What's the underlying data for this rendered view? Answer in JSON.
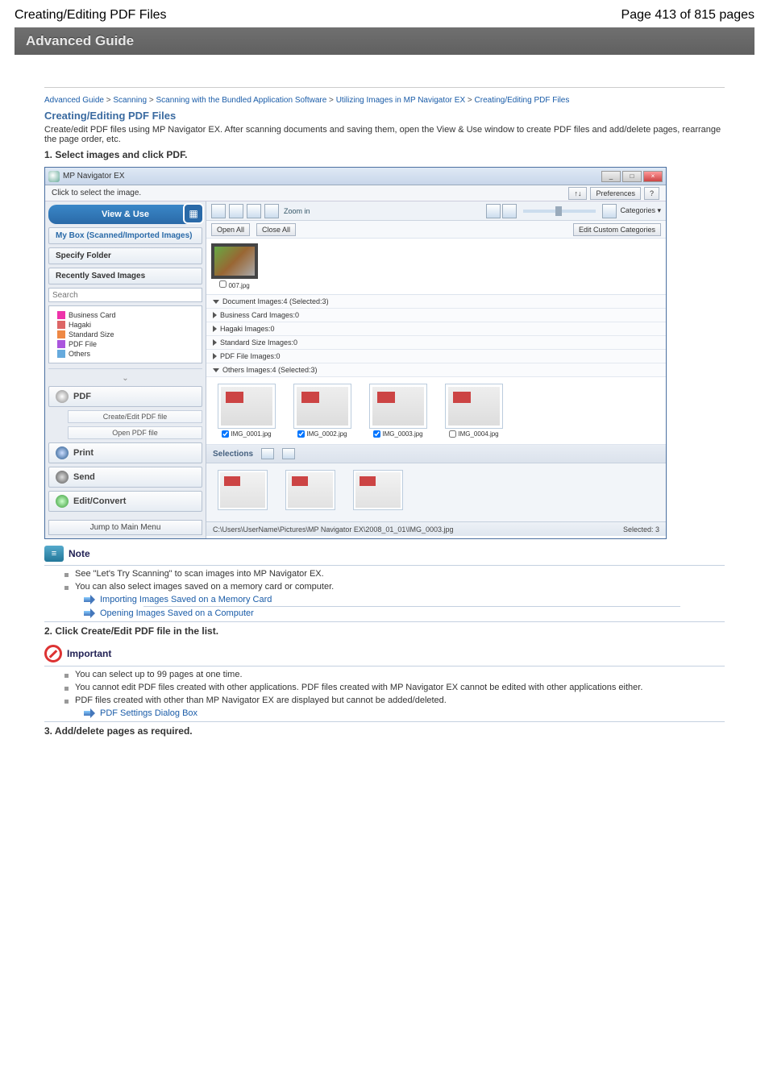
{
  "page": {
    "title_left": "Creating/Editing PDF Files",
    "title_right": "Page 413 of 815 pages",
    "advanced": "Advanced Guide"
  },
  "breadcrumb": [
    "Advanced Guide",
    "Scanning",
    "Scanning with the Bundled Application Software",
    "Utilizing Images in MP Navigator EX",
    "Creating/Editing PDF Files"
  ],
  "sep": " > ",
  "h1": "Creating/Editing PDF Files",
  "intro": "Create/edit PDF files using MP Navigator EX. After scanning documents and saving them, open the View & Use window to create PDF files and add/delete pages, rearrange the page order, etc.",
  "step1": "1. Select images and click PDF.",
  "app": {
    "title": "MP Navigator EX",
    "hint": "Click to select the image.",
    "prefs": "Preferences",
    "sort_ic": "↑↓",
    "help": "?",
    "view_use": "View & Use",
    "nav": {
      "mybox": "My Box (Scanned/Imported Images)",
      "specify": "Specify Folder",
      "recent": "Recently Saved Images"
    },
    "search_ph": "Search",
    "categories_label": "Categories",
    "cats": {
      "business": "Business Card",
      "hagaki": "Hagaki",
      "standard": "Standard Size",
      "pdffile": "PDF File",
      "others": "Others"
    },
    "side": {
      "pdf": "PDF",
      "create": "Create/Edit PDF file",
      "open": "Open PDF file",
      "print": "Print",
      "send": "Send",
      "edit": "Edit/Convert",
      "jump": "Jump to Main Menu"
    },
    "toolbar": {
      "zoom": "Zoom in",
      "cats": "Categories"
    },
    "open_all": "Open All",
    "close_all": "Close All",
    "edit_custom": "Edit Custom Categories",
    "thumb_name": "007.jpg",
    "rows": {
      "doc": "Document   Images:4   (Selected:3)",
      "business": "Business Card   Images:0",
      "hagaki": "Hagaki   Images:0",
      "standard": "Standard Size   Images:0",
      "pdffile": "PDF File   Images:0",
      "others": "Others   Images:4   (Selected:3)"
    },
    "imgs": [
      "IMG_0001.jpg",
      "IMG_0002.jpg",
      "IMG_0003.jpg",
      "IMG_0004.jpg"
    ],
    "selections": "Selections",
    "status_path": "C:\\Users\\UserName\\Pictures\\MP Navigator EX\\2008_01_01\\IMG_0003.jpg",
    "status_sel": "Selected: 3"
  },
  "notebox": {
    "label": "Note"
  },
  "notes": {
    "b1": "See \"Let's Try Scanning\" to scan images into MP Navigator EX.",
    "b2": "You can also select images saved on a memory card or computer.",
    "a1": "Importing Images Saved on a Memory Card",
    "a2": "Opening Images Saved on a Computer"
  },
  "step2": "2. Click Create/Edit PDF file in the list.",
  "important": {
    "label": "Important"
  },
  "imps": {
    "b1": "You can select up to 99 pages at one time.",
    "b2": "You cannot edit PDF files created with other applications. PDF files created with MP Navigator EX cannot be edited with other applications either.",
    "b3": "PDF files created with other than MP Navigator EX are displayed but cannot be added/deleted.",
    "arrow": "PDF Settings Dialog Box"
  },
  "step3": "3. Add/delete pages as required."
}
